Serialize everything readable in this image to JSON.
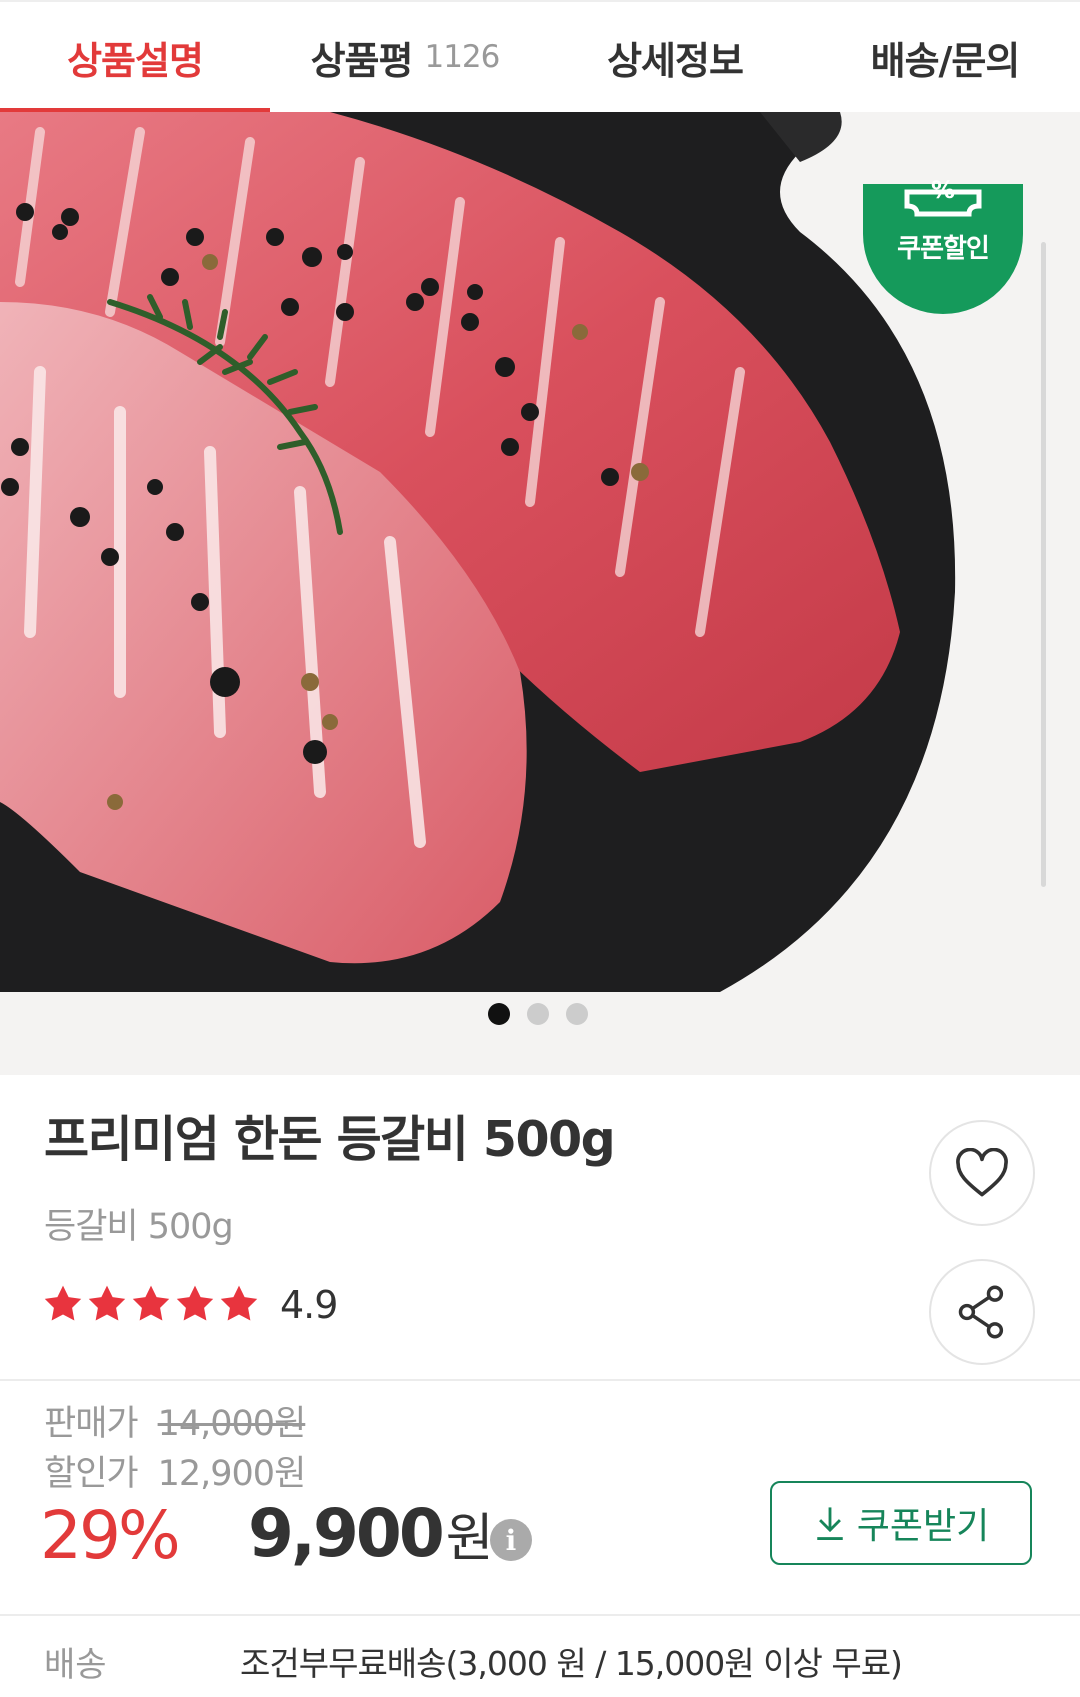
{
  "tabs": [
    {
      "label": "상품설명",
      "count": ""
    },
    {
      "label": "상품평",
      "count": "1126"
    },
    {
      "label": "상세정보",
      "count": ""
    },
    {
      "label": "배송/문의",
      "count": ""
    }
  ],
  "badge": {
    "percent": "%",
    "label": "쿠폰할인",
    "color": "#159a5b"
  },
  "carousel": {
    "total": 3,
    "active": 1
  },
  "product": {
    "title": "프리미엄 한돈 등갈비 500g",
    "subtitle": "등갈비 500g",
    "rating": "4.9",
    "stars": 5
  },
  "price": {
    "sale_label": "판매가",
    "sale_value": "14,000원",
    "discount_label": "할인가",
    "discount_value": "12,900원",
    "percent": "29%",
    "final": "9,900",
    "final_unit": "원",
    "info_icon": "i"
  },
  "coupon_button": "쿠폰받기",
  "shipping": {
    "label": "배송",
    "value": "조건부무료배송(3,000 원 / 15,000원 이상 무료)"
  },
  "colors": {
    "accent": "#e23a3a",
    "green": "#16855a",
    "star": "#e8343e"
  }
}
